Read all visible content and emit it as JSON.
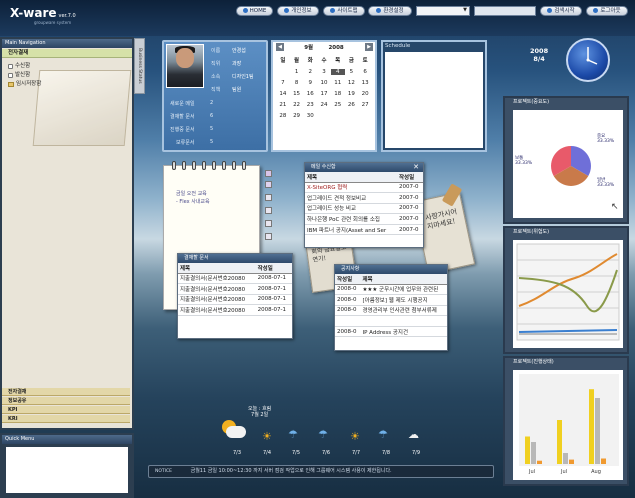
{
  "header": {
    "logo": "X-ware",
    "version": "ver.7.0",
    "sub": "groupware system",
    "buttons": [
      "HOME",
      "개인정보",
      "사이트맵",
      "환경설정"
    ],
    "search": "검색시작",
    "logout": "로그아웃"
  },
  "nav": {
    "title": "Main Navigation",
    "category": "전자결재",
    "items": [
      "수신함",
      "발신함",
      "임시저장함"
    ],
    "bottom": [
      "전자결재",
      "정보공유",
      "KPI",
      "KRI"
    ],
    "quick": "Quick Menu",
    "tab": "Business Status"
  },
  "profile": {
    "rows": [
      [
        "이름",
        "안경섭"
      ],
      [
        "직위",
        "과장"
      ],
      [
        "소속",
        "디자인1팀"
      ],
      [
        "직책",
        "팀원"
      ]
    ],
    "stats": [
      [
        "새로운 메일",
        "2"
      ],
      [
        "결재할 문서",
        "6"
      ],
      [
        "진행중 문서",
        "5"
      ],
      [
        "보류문서",
        "5"
      ]
    ]
  },
  "calendar": {
    "month": "9월",
    "year": "2008",
    "weekdays": [
      "일",
      "월",
      "화",
      "수",
      "목",
      "금",
      "토"
    ],
    "days": [
      "",
      "1",
      "2",
      "3",
      "4",
      "5",
      "6",
      "7",
      "8",
      "9",
      "10",
      "11",
      "12",
      "13",
      "14",
      "15",
      "16",
      "17",
      "18",
      "19",
      "20",
      "21",
      "22",
      "23",
      "24",
      "25",
      "26",
      "27",
      "28",
      "29",
      "30",
      "",
      "",
      "",
      ""
    ],
    "selected": "4"
  },
  "schedule": {
    "title": "Schedule"
  },
  "clock": {
    "year": "2008",
    "date": "8/4"
  },
  "note": {
    "lines": [
      "금일 오전 교육",
      "- Flex 사내교육"
    ]
  },
  "mail": {
    "title": "메일 수신함",
    "cols": [
      "제목",
      "작성일"
    ],
    "rows": [
      [
        "X-SiteORG 협력",
        "2007-0"
      ],
      [
        "업그레이드 견적 정보비교",
        "2007-0"
      ],
      [
        "업그레이드 성능 비교",
        "2007-0"
      ],
      [
        "하나은행 PoC 관련 회의를 소집",
        "2007-0"
      ],
      [
        "IBM 파트너 공지(Asset and Ser",
        "2007-0"
      ]
    ]
  },
  "approval": {
    "title": "결재할 문서",
    "cols": [
      "제목",
      "작성일"
    ],
    "rows": [
      [
        "지출결의서(문서번호20080",
        "2008-07-1"
      ],
      [
        "지출결의서(문서번호20080",
        "2008-07-1"
      ],
      [
        "지출결의서(문서번호20080",
        "2008-07-1"
      ],
      [
        "지출결의서(문서번호20080",
        "2008-07-1"
      ]
    ]
  },
  "notice": {
    "title": "공지사항",
    "cols": [
      "작성일",
      "제목"
    ],
    "rows": [
      [
        "2008-0",
        "★★★ 군무시간에 업무와 관련된"
      ],
      [
        "2008-0",
        "[아름정보] 웹 제도 시행공지"
      ],
      [
        "2008-0",
        "경영관리부 인사관련 첨부서류제"
      ],
      [
        "",
        ""
      ],
      [
        "2008-0",
        "IP Address 공지건"
      ]
    ]
  },
  "sticky": {
    "a": "사랑가시어 지마세요!",
    "b": "회의 금요일로 연기!"
  },
  "pie": {
    "title": "프로젝트(중요도)",
    "labels": [
      [
        "중요",
        "33.33%"
      ],
      [
        "보통",
        "33.33%"
      ],
      [
        "일반",
        "33.33%"
      ]
    ]
  },
  "line": {
    "title": "프로젝트(위험도)"
  },
  "bar": {
    "title": "프로젝트(진행상태)",
    "categories": [
      "Jul",
      "Jul",
      "Aug"
    ],
    "series": [
      {
        "color": "#f0d020",
        "values": [
          25,
          40,
          68
        ]
      },
      {
        "color": "#b8b8b8",
        "values": [
          20,
          10,
          60
        ]
      },
      {
        "color": "#f09a30",
        "values": [
          3,
          4,
          5
        ]
      }
    ]
  },
  "weather": {
    "title": "오늘 : 흐림",
    "sub": "7월 2일",
    "days": [
      "7/3",
      "7/4",
      "7/5",
      "7/6",
      "7/7",
      "7/8",
      "7/9"
    ]
  },
  "ticker": {
    "label": "NOTICE",
    "text": "금월11 금일 10:00~12:30 까지 서버 점검 작업으로 인해 그룹웨어 시스템 사용이 제한됩니다."
  }
}
